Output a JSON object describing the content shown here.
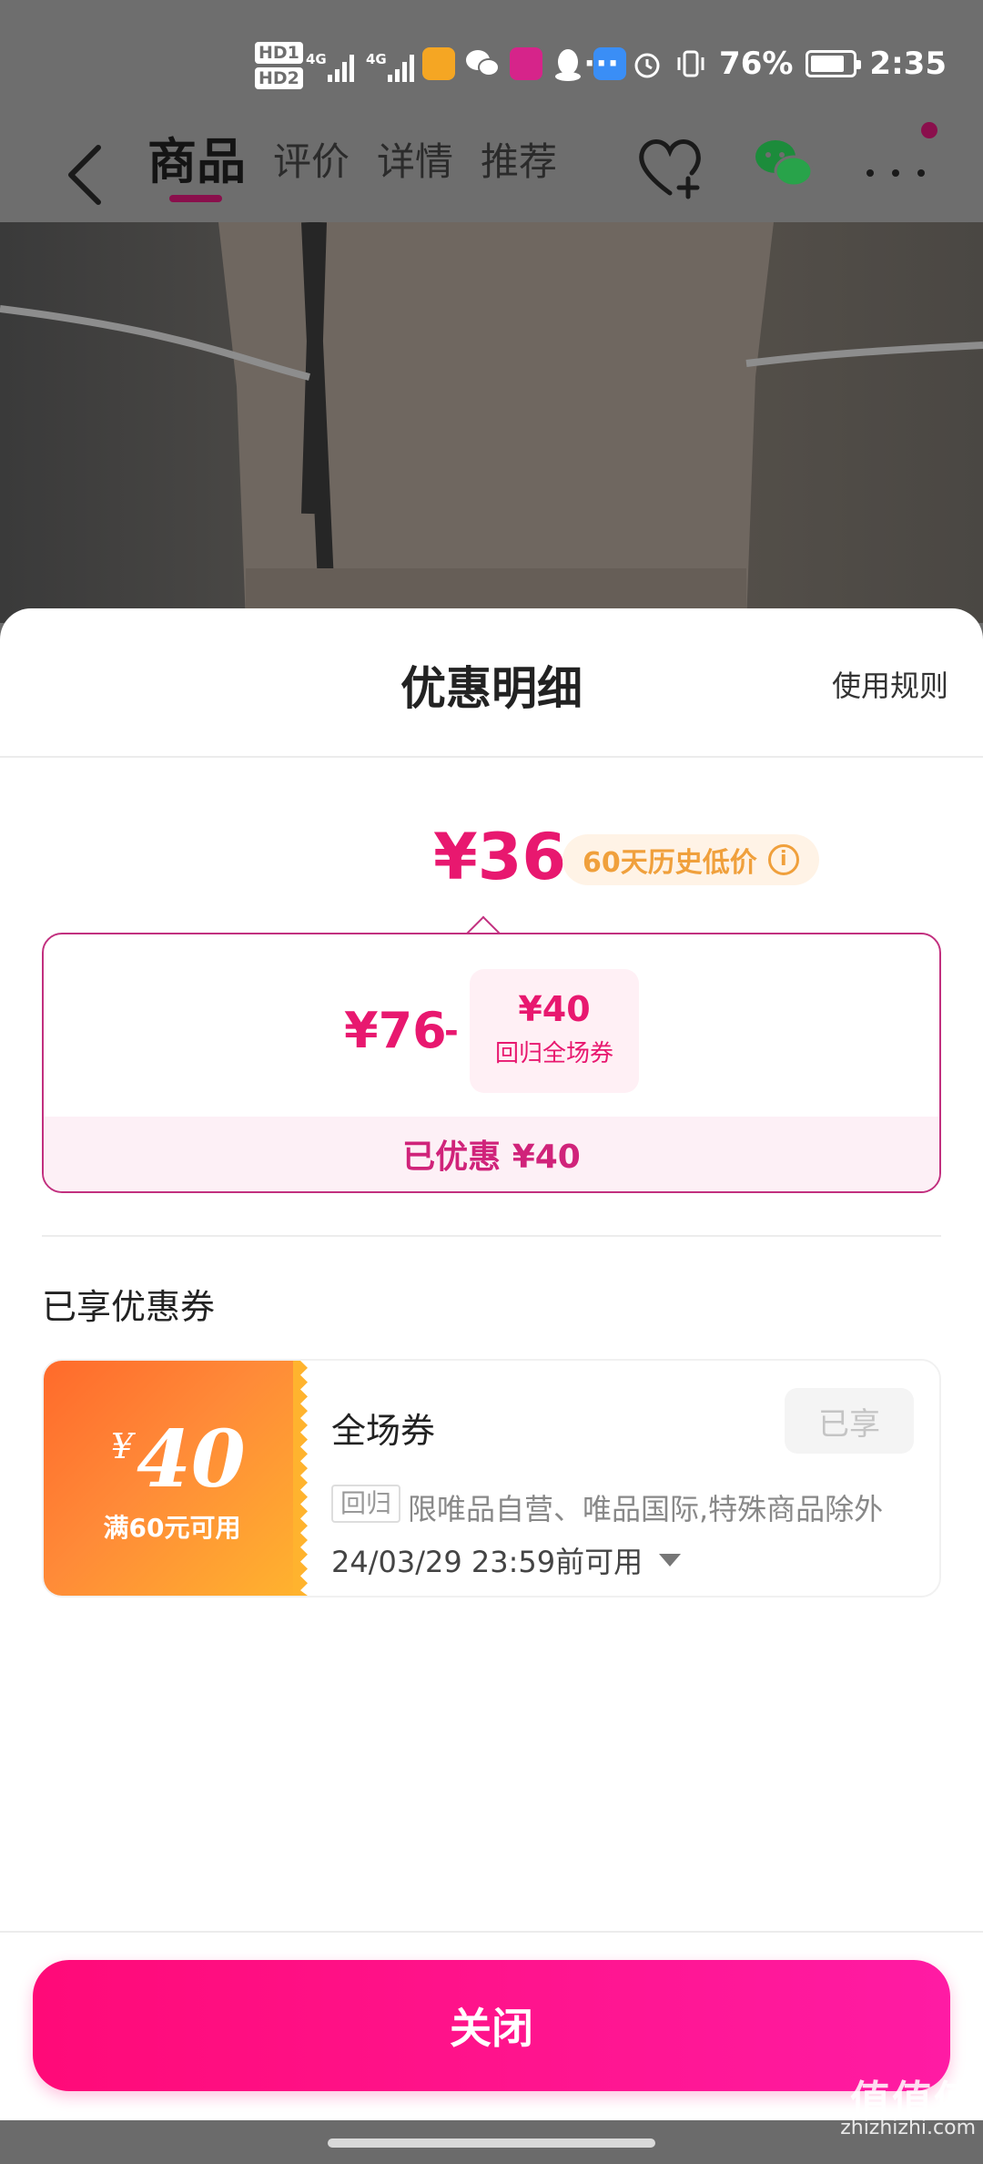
{
  "status_bar": {
    "hd_labels": [
      "HD1",
      "HD2"
    ],
    "network_1": "4G",
    "network_2": "4G",
    "more": "···",
    "battery": "76%",
    "time": "2:35",
    "icons": [
      "signal-icon",
      "app-icon",
      "wechat-icon",
      "app-icon",
      "qq-icon",
      "cloud-icon",
      "alarm-icon",
      "vibrate-icon",
      "battery-icon"
    ]
  },
  "nav": {
    "tabs": [
      "商品",
      "评价",
      "详情",
      "推荐"
    ],
    "active_tab": "商品",
    "icons": [
      "back-icon",
      "heart-plus-icon",
      "wechat-icon",
      "more-icon"
    ]
  },
  "sheet": {
    "title": "优惠明细",
    "rules_link": "使用规则",
    "final_price": "¥36",
    "history_badge": "60天历史低价",
    "breakdown": {
      "original_price": "¥76",
      "minus": "-",
      "coupon_amount": "¥40",
      "coupon_name": "回归全场券",
      "saved": "已优惠 ¥40"
    },
    "coupons_section_title": "已享优惠券",
    "coupon": {
      "currency": "¥",
      "amount": "40",
      "condition": "满60元可用",
      "name": "全场券",
      "state": "已享",
      "tag": "回归",
      "scope": "限唯品自营、唯品国际,特殊商品除外",
      "expire": "24/03/29 23:59前可用"
    },
    "close_button": "关闭"
  },
  "watermark": {
    "logo": "值值值",
    "url": "zhizhizhi.com"
  },
  "colors": {
    "accent": "#e8186f",
    "button": "#ff0a78",
    "coupon_gradient_start": "#ff6a2b",
    "coupon_gradient_end": "#ffb32e",
    "history_badge_text": "#f0a03c"
  }
}
